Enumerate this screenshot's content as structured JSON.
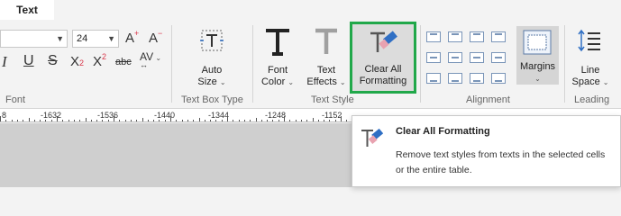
{
  "tabs": {
    "active": "Text"
  },
  "font_group": {
    "size_value": "24",
    "grow_label": "A",
    "shrink_label": "A",
    "superscript_label": "X",
    "subscript_label": "X",
    "strikethrough_label": "abc",
    "spacing_label": "AV",
    "label": "Font"
  },
  "text_box_group": {
    "auto_size_line1": "Auto",
    "auto_size_line2": "Size",
    "label": "Text Box Type"
  },
  "text_style_group": {
    "font_color_line1": "Font",
    "font_color_line2": "Color",
    "text_effects_line1": "Text",
    "text_effects_line2": "Effects",
    "clear_line1": "Clear All",
    "clear_line2": "Formatting",
    "label": "Text Style"
  },
  "alignment_group": {
    "margins_label": "Margins",
    "label": "Alignment"
  },
  "leading_group": {
    "line_space_line1": "Line",
    "line_space_line2": "Space",
    "label": "Leading"
  },
  "ruler": {
    "ticks": [
      "8",
      "-1632",
      "-1536",
      "-1440",
      "-1344",
      "-1248",
      "-1152"
    ]
  },
  "tooltip": {
    "title": "Clear All Formatting",
    "description": "Remove text styles from texts in the selected cells or the entire table."
  },
  "colors": {
    "highlight": "#21a84a",
    "accent_red": "#d9364a",
    "icon_blue": "#2f6fc4"
  }
}
